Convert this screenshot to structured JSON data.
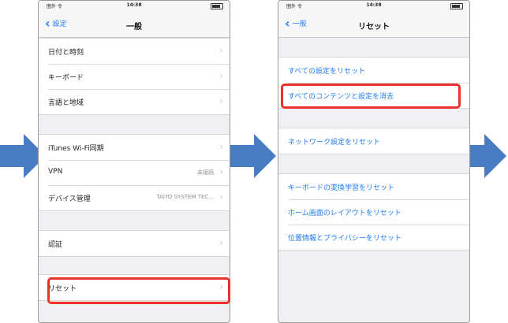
{
  "status_bar": {
    "carrier": "圏外 令",
    "time": "14:38"
  },
  "screen1": {
    "back_label": "設定",
    "title": "一般",
    "rows": [
      {
        "label": "日付と時刻"
      },
      {
        "label": "キーボード"
      },
      {
        "label": "言語と地域"
      },
      {
        "label": "iTunes Wi-Fi同期"
      },
      {
        "label": "VPN",
        "value": "未接続"
      },
      {
        "label": "デバイス管理",
        "value": "TAIYO SYSTEM TEC..."
      },
      {
        "label": "認証"
      },
      {
        "label": "リセット"
      }
    ]
  },
  "screen2": {
    "back_label": "一般",
    "title": "リセット",
    "rows": [
      {
        "label": "すべての設定をリセット"
      },
      {
        "label": "すべてのコンテンツと設定を消去"
      },
      {
        "label": "ネットワーク設定をリセット"
      },
      {
        "label": "キーボードの変換学習をリセット"
      },
      {
        "label": "ホーム画面のレイアウトをリセット"
      },
      {
        "label": "位置情報とプライバシーをリセット"
      }
    ]
  },
  "colors": {
    "accent": "#1e7cf4",
    "highlight": "#e8322a",
    "arrow": "#4a7cc4"
  },
  "icons": {
    "back": "chevron-left-icon",
    "disclosure": "chevron-right-icon",
    "step": "arrow-right-icon"
  }
}
